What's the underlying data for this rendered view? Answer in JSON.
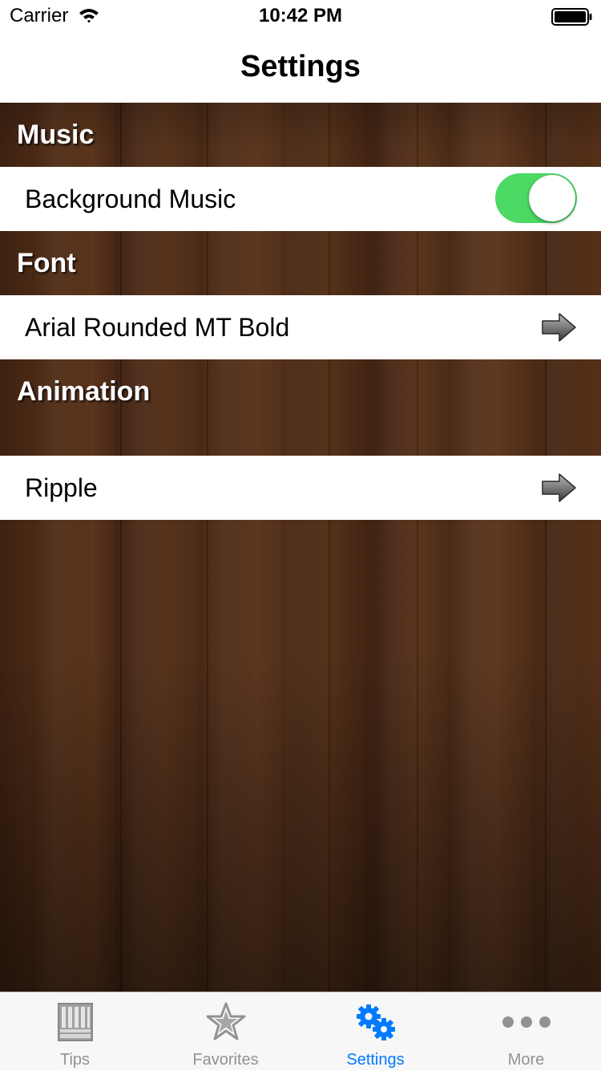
{
  "status_bar": {
    "carrier": "Carrier",
    "time": "10:42 PM"
  },
  "nav": {
    "title": "Settings"
  },
  "sections": [
    {
      "header": "Music",
      "row_label": "Background Music",
      "control": "toggle",
      "toggle_on": true
    },
    {
      "header": "Font",
      "row_label": "Arial Rounded MT Bold",
      "control": "disclosure-arrow"
    },
    {
      "header": "Animation",
      "row_label": "Ripple",
      "control": "disclosure-arrow"
    }
  ],
  "tabs": [
    {
      "label": "Tips",
      "icon": "piano-icon",
      "active": false
    },
    {
      "label": "Favorites",
      "icon": "star-icon",
      "active": false
    },
    {
      "label": "Settings",
      "icon": "gears-icon",
      "active": true
    },
    {
      "label": "More",
      "icon": "more-dots-icon",
      "active": false
    }
  ],
  "colors": {
    "toggle_on": "#4cd964",
    "tab_active": "#007aff",
    "tab_inactive": "#929292",
    "wood": "#4a2a16"
  }
}
